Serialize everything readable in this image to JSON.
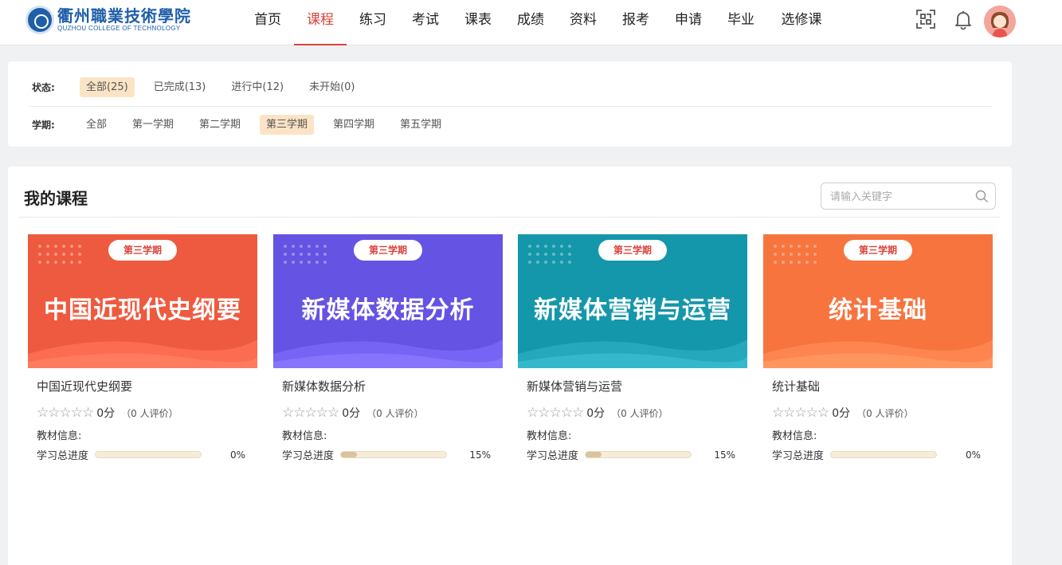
{
  "header": {
    "logo_cn": "衢州職業技術學院",
    "logo_en": "QUZHOU COLLEGE OF TECHNOLOGY",
    "nav": [
      {
        "label": "首页",
        "active": false
      },
      {
        "label": "课程",
        "active": true
      },
      {
        "label": "练习",
        "active": false
      },
      {
        "label": "考试",
        "active": false
      },
      {
        "label": "课表",
        "active": false
      },
      {
        "label": "成绩",
        "active": false
      },
      {
        "label": "资料",
        "active": false
      },
      {
        "label": "报考",
        "active": false
      },
      {
        "label": "申请",
        "active": false
      },
      {
        "label": "毕业",
        "active": false
      },
      {
        "label": "选修课",
        "active": false
      }
    ],
    "icons": [
      "scan-icon",
      "bell-icon"
    ],
    "accent": "#d9433a"
  },
  "filters": {
    "status_label": "状态:",
    "status": [
      {
        "label": "全部(25)",
        "active": true
      },
      {
        "label": "已完成(13)",
        "active": false
      },
      {
        "label": "进行中(12)",
        "active": false
      },
      {
        "label": "未开始(0)",
        "active": false
      }
    ],
    "term_label": "学期:",
    "terms": [
      {
        "label": "全部",
        "active": false
      },
      {
        "label": "第一学期",
        "active": false
      },
      {
        "label": "第二学期",
        "active": false
      },
      {
        "label": "第三学期",
        "active": true
      },
      {
        "label": "第四学期",
        "active": false
      },
      {
        "label": "第五学期",
        "active": false
      }
    ]
  },
  "main": {
    "title": "我的课程",
    "search_placeholder": "请输入关键字",
    "material_label": "教材信息:",
    "progress_label": "学习总进度",
    "courses": [
      {
        "term": "第三学期",
        "cover_title": "中国近现代史纲要",
        "name": "中国近现代史纲要",
        "stars": "☆☆☆☆☆",
        "score": "0分",
        "reviews": "（0 人评价）",
        "progress": 0,
        "progress_text": "0%",
        "color": "#ee5a3f",
        "term_color": "#d9433a"
      },
      {
        "term": "第三学期",
        "cover_title": "新媒体数据分析",
        "name": "新媒体数据分析",
        "stars": "☆☆☆☆☆",
        "score": "0分",
        "reviews": "（0 人评价）",
        "progress": 15,
        "progress_text": "15%",
        "color": "#6553e3",
        "term_color": "#d9433a"
      },
      {
        "term": "第三学期",
        "cover_title": "新媒体营销与运营",
        "name": "新媒体营销与运营",
        "stars": "☆☆☆☆☆",
        "score": "0分",
        "reviews": "（0 人评价）",
        "progress": 15,
        "progress_text": "15%",
        "color": "#1497aa",
        "term_color": "#d9433a"
      },
      {
        "term": "第三学期",
        "cover_title": "统计基础",
        "name": "统计基础",
        "stars": "☆☆☆☆☆",
        "score": "0分",
        "reviews": "（0 人评价）",
        "progress": 0,
        "progress_text": "0%",
        "color": "#f7743f",
        "term_color": "#d9433a"
      }
    ]
  }
}
